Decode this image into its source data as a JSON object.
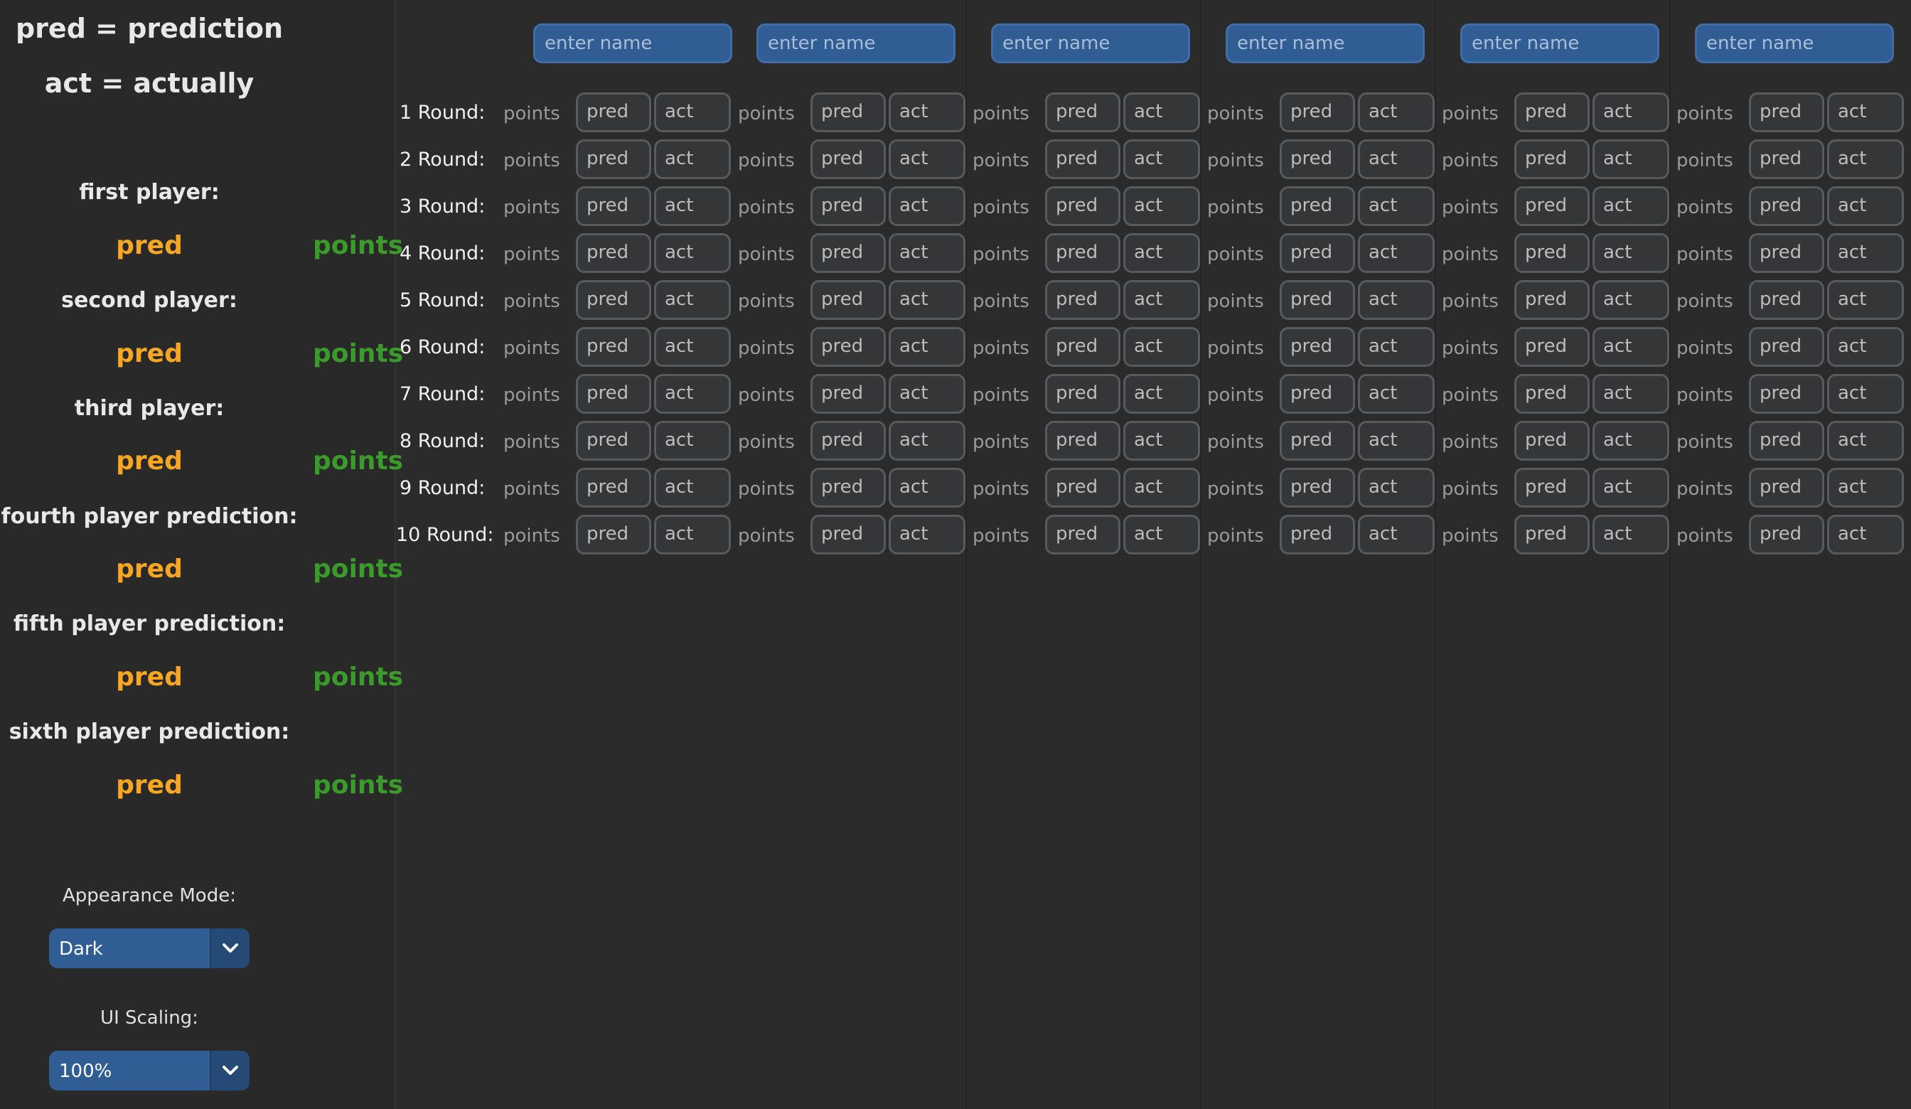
{
  "sidebar": {
    "legend_pred": "pred = prediction",
    "legend_act": "act = actually",
    "players": [
      {
        "label": "first player:",
        "pred": "pred",
        "points": "points"
      },
      {
        "label": "second player:",
        "pred": "pred",
        "points": "points"
      },
      {
        "label": "third player:",
        "pred": "pred",
        "points": "points"
      },
      {
        "label": "fourth player prediction:",
        "pred": "pred",
        "points": "points"
      },
      {
        "label": "fifth player prediction:",
        "pred": "pred",
        "points": "points"
      },
      {
        "label": "sixth player prediction:",
        "pred": "pred",
        "points": "points"
      }
    ],
    "appearance_label": "Appearance Mode:",
    "appearance_value": "Dark",
    "scaling_label": "UI Scaling:",
    "scaling_value": "100%"
  },
  "table": {
    "name_placeholder": "enter name",
    "points_text": "points",
    "pred_placeholder": "pred",
    "act_placeholder": "act",
    "rounds": [
      "1 Round:",
      "2 Round:",
      "3 Round:",
      "4 Round:",
      "5 Round:",
      "6 Round:",
      "7 Round:",
      "8 Round:",
      "9 Round:",
      "10 Round:"
    ],
    "player_count": 6
  },
  "colors": {
    "accent_blue": "#2f5d94",
    "pred_orange": "#f5a623",
    "points_green": "#3a9a2a",
    "background": "#2b2b2b"
  },
  "icons": {
    "dropdown": "chevron-down-icon"
  }
}
